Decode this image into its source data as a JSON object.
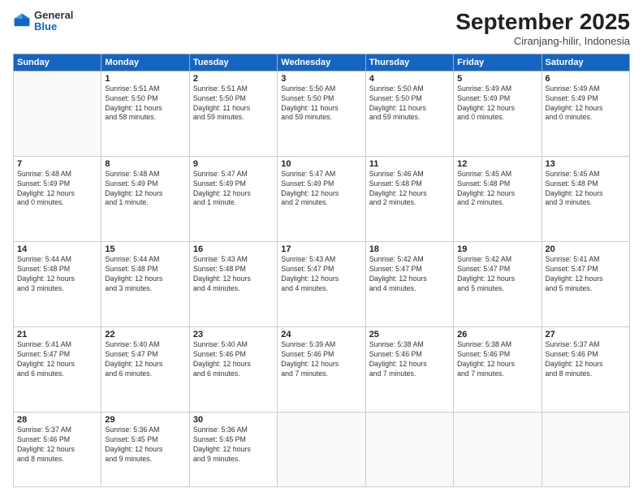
{
  "logo": {
    "general": "General",
    "blue": "Blue"
  },
  "header": {
    "month": "September 2025",
    "location": "Ciranjang-hilir, Indonesia"
  },
  "weekdays": [
    "Sunday",
    "Monday",
    "Tuesday",
    "Wednesday",
    "Thursday",
    "Friday",
    "Saturday"
  ],
  "weeks": [
    [
      {
        "day": "",
        "info": ""
      },
      {
        "day": "1",
        "info": "Sunrise: 5:51 AM\nSunset: 5:50 PM\nDaylight: 11 hours\nand 58 minutes."
      },
      {
        "day": "2",
        "info": "Sunrise: 5:51 AM\nSunset: 5:50 PM\nDaylight: 11 hours\nand 59 minutes."
      },
      {
        "day": "3",
        "info": "Sunrise: 5:50 AM\nSunset: 5:50 PM\nDaylight: 11 hours\nand 59 minutes."
      },
      {
        "day": "4",
        "info": "Sunrise: 5:50 AM\nSunset: 5:50 PM\nDaylight: 11 hours\nand 59 minutes."
      },
      {
        "day": "5",
        "info": "Sunrise: 5:49 AM\nSunset: 5:49 PM\nDaylight: 12 hours\nand 0 minutes."
      },
      {
        "day": "6",
        "info": "Sunrise: 5:49 AM\nSunset: 5:49 PM\nDaylight: 12 hours\nand 0 minutes."
      }
    ],
    [
      {
        "day": "7",
        "info": "Sunrise: 5:48 AM\nSunset: 5:49 PM\nDaylight: 12 hours\nand 0 minutes."
      },
      {
        "day": "8",
        "info": "Sunrise: 5:48 AM\nSunset: 5:49 PM\nDaylight: 12 hours\nand 1 minute."
      },
      {
        "day": "9",
        "info": "Sunrise: 5:47 AM\nSunset: 5:49 PM\nDaylight: 12 hours\nand 1 minute."
      },
      {
        "day": "10",
        "info": "Sunrise: 5:47 AM\nSunset: 5:49 PM\nDaylight: 12 hours\nand 2 minutes."
      },
      {
        "day": "11",
        "info": "Sunrise: 5:46 AM\nSunset: 5:48 PM\nDaylight: 12 hours\nand 2 minutes."
      },
      {
        "day": "12",
        "info": "Sunrise: 5:45 AM\nSunset: 5:48 PM\nDaylight: 12 hours\nand 2 minutes."
      },
      {
        "day": "13",
        "info": "Sunrise: 5:45 AM\nSunset: 5:48 PM\nDaylight: 12 hours\nand 3 minutes."
      }
    ],
    [
      {
        "day": "14",
        "info": "Sunrise: 5:44 AM\nSunset: 5:48 PM\nDaylight: 12 hours\nand 3 minutes."
      },
      {
        "day": "15",
        "info": "Sunrise: 5:44 AM\nSunset: 5:48 PM\nDaylight: 12 hours\nand 3 minutes."
      },
      {
        "day": "16",
        "info": "Sunrise: 5:43 AM\nSunset: 5:48 PM\nDaylight: 12 hours\nand 4 minutes."
      },
      {
        "day": "17",
        "info": "Sunrise: 5:43 AM\nSunset: 5:47 PM\nDaylight: 12 hours\nand 4 minutes."
      },
      {
        "day": "18",
        "info": "Sunrise: 5:42 AM\nSunset: 5:47 PM\nDaylight: 12 hours\nand 4 minutes."
      },
      {
        "day": "19",
        "info": "Sunrise: 5:42 AM\nSunset: 5:47 PM\nDaylight: 12 hours\nand 5 minutes."
      },
      {
        "day": "20",
        "info": "Sunrise: 5:41 AM\nSunset: 5:47 PM\nDaylight: 12 hours\nand 5 minutes."
      }
    ],
    [
      {
        "day": "21",
        "info": "Sunrise: 5:41 AM\nSunset: 5:47 PM\nDaylight: 12 hours\nand 6 minutes."
      },
      {
        "day": "22",
        "info": "Sunrise: 5:40 AM\nSunset: 5:47 PM\nDaylight: 12 hours\nand 6 minutes."
      },
      {
        "day": "23",
        "info": "Sunrise: 5:40 AM\nSunset: 5:46 PM\nDaylight: 12 hours\nand 6 minutes."
      },
      {
        "day": "24",
        "info": "Sunrise: 5:39 AM\nSunset: 5:46 PM\nDaylight: 12 hours\nand 7 minutes."
      },
      {
        "day": "25",
        "info": "Sunrise: 5:38 AM\nSunset: 5:46 PM\nDaylight: 12 hours\nand 7 minutes."
      },
      {
        "day": "26",
        "info": "Sunrise: 5:38 AM\nSunset: 5:46 PM\nDaylight: 12 hours\nand 7 minutes."
      },
      {
        "day": "27",
        "info": "Sunrise: 5:37 AM\nSunset: 5:46 PM\nDaylight: 12 hours\nand 8 minutes."
      }
    ],
    [
      {
        "day": "28",
        "info": "Sunrise: 5:37 AM\nSunset: 5:46 PM\nDaylight: 12 hours\nand 8 minutes."
      },
      {
        "day": "29",
        "info": "Sunrise: 5:36 AM\nSunset: 5:45 PM\nDaylight: 12 hours\nand 9 minutes."
      },
      {
        "day": "30",
        "info": "Sunrise: 5:36 AM\nSunset: 5:45 PM\nDaylight: 12 hours\nand 9 minutes."
      },
      {
        "day": "",
        "info": ""
      },
      {
        "day": "",
        "info": ""
      },
      {
        "day": "",
        "info": ""
      },
      {
        "day": "",
        "info": ""
      }
    ]
  ]
}
